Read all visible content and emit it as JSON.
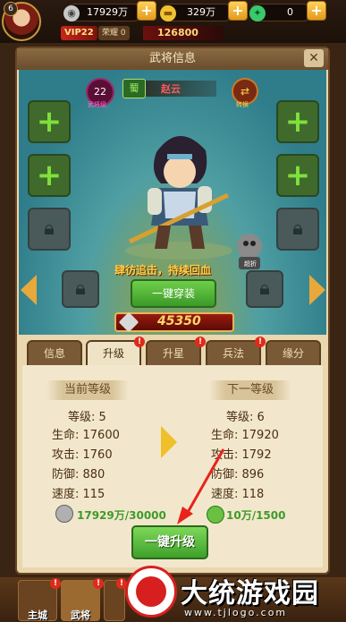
{
  "topbar": {
    "player_level": "6",
    "silver": "17929万",
    "gold": "329万",
    "jade": "0",
    "vip": "VIP22",
    "honor": "荣耀 0",
    "power": "126800",
    "icons": [
      "silver-coin-icon",
      "gold-ingot-icon",
      "jade-icon",
      "plus-icon"
    ]
  },
  "panel": {
    "title": "武将信息",
    "close": "✕"
  },
  "hero": {
    "level": "22",
    "level_label": "武将级",
    "kingdom": "蜀",
    "name": "赵云",
    "swap_label": "转换",
    "skill": "肆彷追击，持续回血",
    "discount_label": "超折",
    "equip_button": "一键穿装",
    "power": "45350"
  },
  "tabs": [
    {
      "label": "信息",
      "active": false,
      "badge": ""
    },
    {
      "label": "升级",
      "active": true,
      "badge": "!"
    },
    {
      "label": "升星",
      "active": false,
      "badge": "!"
    },
    {
      "label": "兵法",
      "active": false,
      "badge": "!"
    },
    {
      "label": "缘分",
      "active": false,
      "badge": ""
    }
  ],
  "upgrade": {
    "current_header": "当前等级",
    "next_header": "下一等级",
    "current": {
      "level": "等级: 5",
      "hp": "生命: 17600",
      "atk": "攻击: 1760",
      "def": "防御: 880",
      "spd": "速度: 115"
    },
    "next": {
      "level": "等级: 6",
      "hp": "生命: 17920",
      "atk": "攻击: 1792",
      "def": "防御: 896",
      "spd": "速度: 118"
    },
    "silver_cost": "17929万/30000",
    "potion_cost": "10万/1500",
    "button": "一键升级"
  },
  "nav": [
    {
      "label": "主城",
      "badge": "!"
    },
    {
      "label": "武将",
      "badge": "!"
    },
    {
      "label": "",
      "badge": "!"
    }
  ],
  "watermark": {
    "title": "大统游戏园",
    "url": "www.tjlogo.com"
  },
  "colors": {
    "accent_green": "#3da02a",
    "power_red": "#9a1a0e",
    "badge_red": "#e12a1a",
    "gold": "#ffd86a"
  }
}
